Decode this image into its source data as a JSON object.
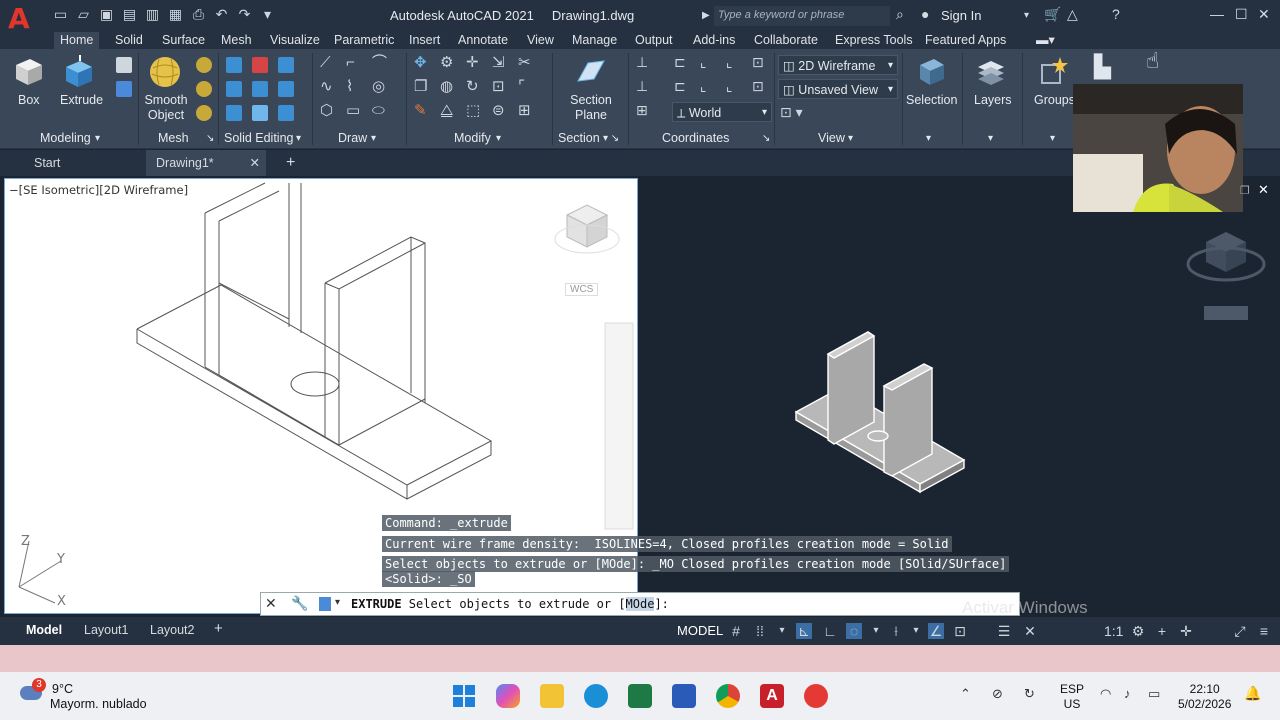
{
  "titlebar": {
    "app_title": "Autodesk AutoCAD 2021",
    "file_name": "Drawing1.dwg",
    "search_placeholder": "Type a keyword or phrase",
    "sign_in": "Sign In"
  },
  "ribbon_tabs": [
    "Home",
    "Solid",
    "Surface",
    "Mesh",
    "Visualize",
    "Parametric",
    "Insert",
    "Annotate",
    "View",
    "Manage",
    "Output",
    "Add-ins",
    "Collaborate",
    "Express Tools",
    "Featured Apps"
  ],
  "ribbon": {
    "box": "Box",
    "extrude": "Extrude",
    "smooth_object": "Smooth Object",
    "section_plane": "Section Plane",
    "selection": "Selection",
    "layers": "Layers",
    "groups": "Groups",
    "visual_style": "2D Wireframe",
    "view_state": "Unsaved View",
    "ucs": "World",
    "panels": {
      "modeling": "Modeling",
      "mesh": "Mesh",
      "solid_editing": "Solid Editing",
      "draw": "Draw",
      "modify": "Modify",
      "section": "Section",
      "coordinates": "Coordinates",
      "view": "View"
    }
  },
  "file_tabs": {
    "start": "Start",
    "drawing": "Drawing1*"
  },
  "viewport_left": {
    "label": "[SE Isometric][2D Wireframe]",
    "wcs": "WCS"
  },
  "command": {
    "history": [
      "Command: _extrude",
      "Current wire frame density:  ISOLINES=4, Closed profiles creation mode = Solid",
      "Select objects to extrude or [MOde]: _MO Closed profiles creation mode [SOlid/SUrface]",
      "<Solid>: _SO"
    ],
    "prompt_cmd": "EXTRUDE",
    "prompt_text": " Select objects to extrude or [",
    "prompt_option": "MOde",
    "prompt_end": "]:"
  },
  "watermark": "Activar Windows",
  "layout_tabs": [
    "Model",
    "Layout1",
    "Layout2"
  ],
  "status": {
    "model": "MODEL"
  },
  "taskbar": {
    "temp": "9°C",
    "weather": "Mayorm. nublado",
    "weather_badge": "3",
    "lang1": "ESP",
    "lang2": "US",
    "time": "22:10",
    "date": "5/02/2026"
  }
}
